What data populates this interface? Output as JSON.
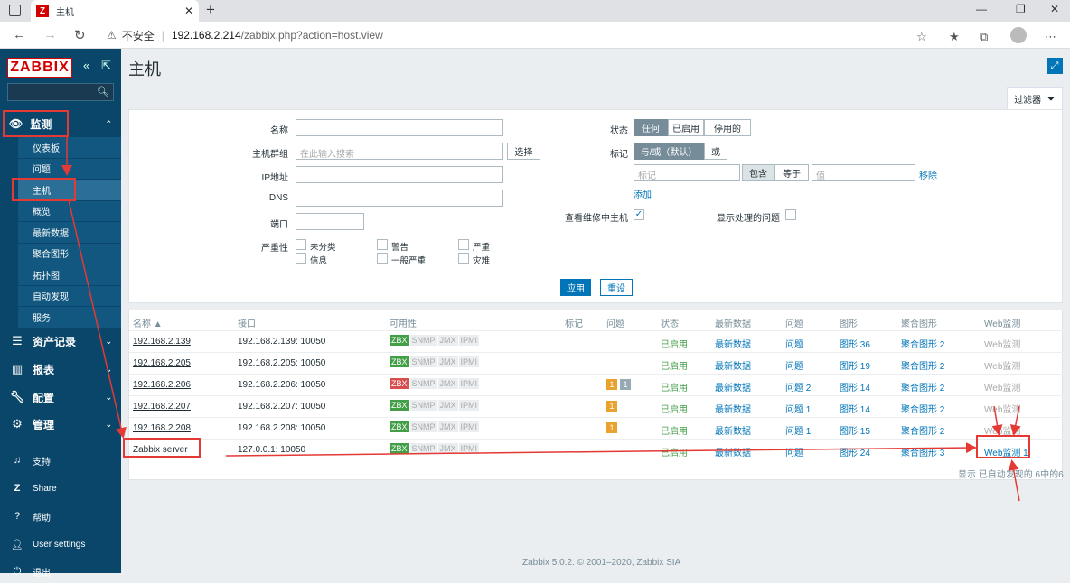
{
  "browser": {
    "tab_title": "主机",
    "address_warning": "不安全",
    "url_host": "192.168.2.214",
    "url_path": "/zabbix.php?action=host.view"
  },
  "sidebar": {
    "logo": "ZABBIX",
    "monitor_label": "监测",
    "sub_items": [
      "仪表板",
      "问题",
      "主机",
      "概览",
      "最新数据",
      "聚合图形",
      "拓扑图",
      "自动发现",
      "服务"
    ],
    "main_items": [
      "资产记录",
      "报表",
      "配置",
      "管理"
    ],
    "bottom_items": [
      "支持",
      "Share",
      "帮助",
      "User settings",
      "退出"
    ]
  },
  "page": {
    "title": "主机",
    "filter_tab": "过滤器"
  },
  "filter": {
    "name_label": "名称",
    "hostgroup_label": "主机群组",
    "hostgroup_placeholder": "在此输入搜索",
    "select_btn": "选择",
    "ip_label": "IP地址",
    "dns_label": "DNS",
    "port_label": "端口",
    "severity_label": "严重性",
    "severities": [
      "未分类",
      "警告",
      "严重",
      "信息",
      "一般严重",
      "灾难"
    ],
    "status_label": "状态",
    "status_options": [
      "任何",
      "已启用",
      "停用的"
    ],
    "tags_label": "标记",
    "tag_mode_options": [
      "与/或（默认）",
      "或"
    ],
    "tag_placeholder": "标记",
    "tag_op_options": [
      "包含",
      "等于"
    ],
    "value_placeholder": "值",
    "remove": "移除",
    "add": "添加",
    "maint_label": "查看维修中主机",
    "suppressed_label": "显示处理的问题",
    "apply": "应用",
    "reset": "重设"
  },
  "table": {
    "headers": [
      "名称 ▲",
      "接口",
      "可用性",
      "标记",
      "问题",
      "状态",
      "最新数据",
      "问题",
      "图形",
      "聚合图形",
      "Web监测"
    ],
    "avail_tags": [
      "ZBX",
      "SNMP",
      "JMX",
      "IPMI"
    ],
    "rows": [
      {
        "name": "192.168.2.139",
        "iface": "192.168.2.139: 10050",
        "status": "已启用",
        "latest": "最新数据",
        "problems": "问题",
        "graphs": "图形 36",
        "screens": "聚合图形 2",
        "web": "Web监测"
      },
      {
        "name": "192.168.2.205",
        "iface": "192.168.2.205: 10050",
        "status": "已启用",
        "latest": "最新数据",
        "problems": "问题",
        "graphs": "图形 19",
        "screens": "聚合图形 2",
        "web": "Web监测"
      },
      {
        "name": "192.168.2.206",
        "iface": "192.168.2.206: 10050",
        "status": "已启用",
        "latest": "最新数据",
        "problems": "问题 2",
        "graphs": "图形 14",
        "screens": "聚合图形 2",
        "web": "Web监测",
        "p1": "1",
        "p2": "1"
      },
      {
        "name": "192.168.2.207",
        "iface": "192.168.2.207: 10050",
        "status": "已启用",
        "latest": "最新数据",
        "problems": "问题 1",
        "graphs": "图形 14",
        "screens": "聚合图形 2",
        "web": "Web监测",
        "p1": "1"
      },
      {
        "name": "192.168.2.208",
        "iface": "192.168.2.208: 10050",
        "status": "已启用",
        "latest": "最新数据",
        "problems": "问题 1",
        "graphs": "图形 15",
        "screens": "聚合图形 2",
        "web": "Web监测",
        "p1": "1"
      },
      {
        "name": "Zabbix server",
        "iface": "127.0.0.1: 10050",
        "status": "已启用",
        "latest": "最新数据",
        "problems": "问题",
        "graphs": "图形 24",
        "screens": "聚合图形 3",
        "web": "Web监测 1"
      }
    ],
    "count_text": "显示 已自动发现的 6中的6"
  },
  "footer": {
    "copyright": "Zabbix 5.0.2. © 2001–2020, Zabbix SIA"
  }
}
